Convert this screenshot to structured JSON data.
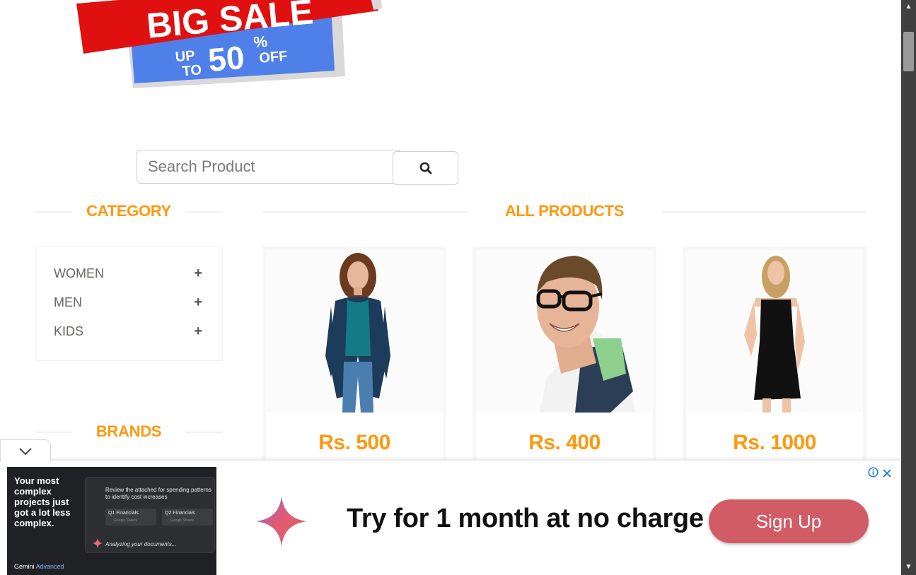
{
  "banner": {
    "line1": "BIG SALE",
    "up": "UP",
    "to": "TO",
    "amount": "50",
    "percent": "%",
    "off": "OFF"
  },
  "search": {
    "placeholder": "Search Product",
    "button_icon": "search-icon"
  },
  "sidebar": {
    "category_title": "CATEGORY",
    "categories": [
      {
        "label": "WOMEN",
        "icon": "plus-icon"
      },
      {
        "label": "MEN",
        "icon": "plus-icon"
      },
      {
        "label": "KIDS",
        "icon": "plus-icon"
      }
    ],
    "brands_title": "BRANDS"
  },
  "main": {
    "section_title": "ALL PRODUCTS",
    "products": [
      {
        "price": "Rs. 500"
      },
      {
        "price": "Rs. 400"
      },
      {
        "price": "Rs. 1000"
      }
    ]
  },
  "ad": {
    "left_headline": "Your most complex projects just got a lot less complex.",
    "panel_text": "Review the attached for spending patterns to identify cost increases",
    "chip1": "Q1 Financials",
    "chip2": "Q2 Financials",
    "chip_sub": "Google Sheets",
    "analyzing": "Analyzing your documents...",
    "brand": "Gemini",
    "brand_suffix": "Advanced",
    "headline": "Try for 1 month at no charge",
    "cta": "Sign Up",
    "info_icon": "info-icon",
    "close_icon": "close-icon",
    "collapse_icon": "chevron-down-icon"
  },
  "colors": {
    "accent": "#fe980f",
    "cta": "#d25c66",
    "sale_red": "#e01010",
    "sale_blue": "#4f7fe8"
  }
}
